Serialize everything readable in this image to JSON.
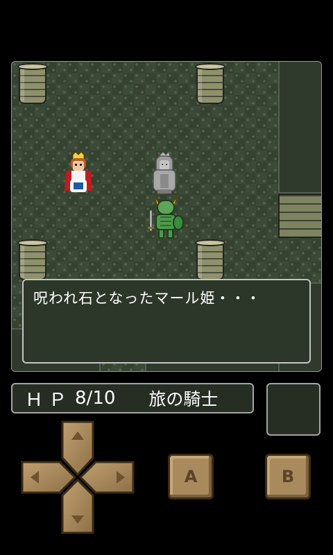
{
  "dialog": {
    "text": "呪われ石となったマール姫・・・"
  },
  "status": {
    "hp_label": "ＨＰ",
    "hp_value": "8/10",
    "class_name": "旅の騎士"
  },
  "controls": {
    "a_label": "A",
    "b_label": "B"
  },
  "icons": {
    "dpad": "dpad-icon",
    "arrow_up": "arrow-up-icon",
    "arrow_down": "arrow-down-icon",
    "arrow_left": "arrow-left-icon",
    "arrow_right": "arrow-right-icon"
  },
  "colors": {
    "floor": "#3b4a37",
    "dialog_bg": "#2c3629",
    "panel_border": "#a6a6a6",
    "button": "#a88a5d"
  }
}
